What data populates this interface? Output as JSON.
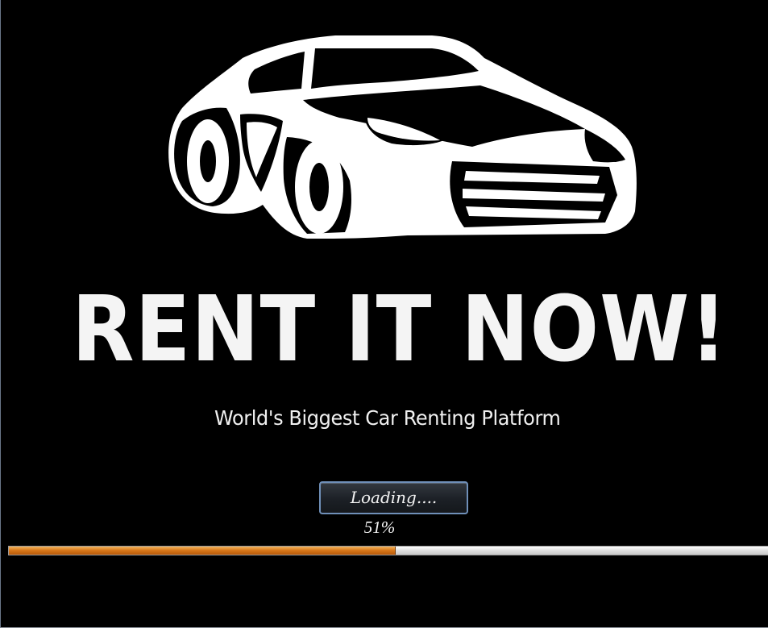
{
  "splash": {
    "title": "RENT IT NOW!",
    "tagline": "World's Biggest Car Renting Platform",
    "logo_icon": "sports-car-icon",
    "loading_button_label": "Loading....",
    "progress_percent_label": "51%",
    "progress_value": 0.51
  },
  "colors": {
    "background": "#000000",
    "text": "#f4f4f4",
    "progress_fill": "#d9791b",
    "progress_track": "#dcdcdc",
    "button_border": "#6f8fb8"
  }
}
